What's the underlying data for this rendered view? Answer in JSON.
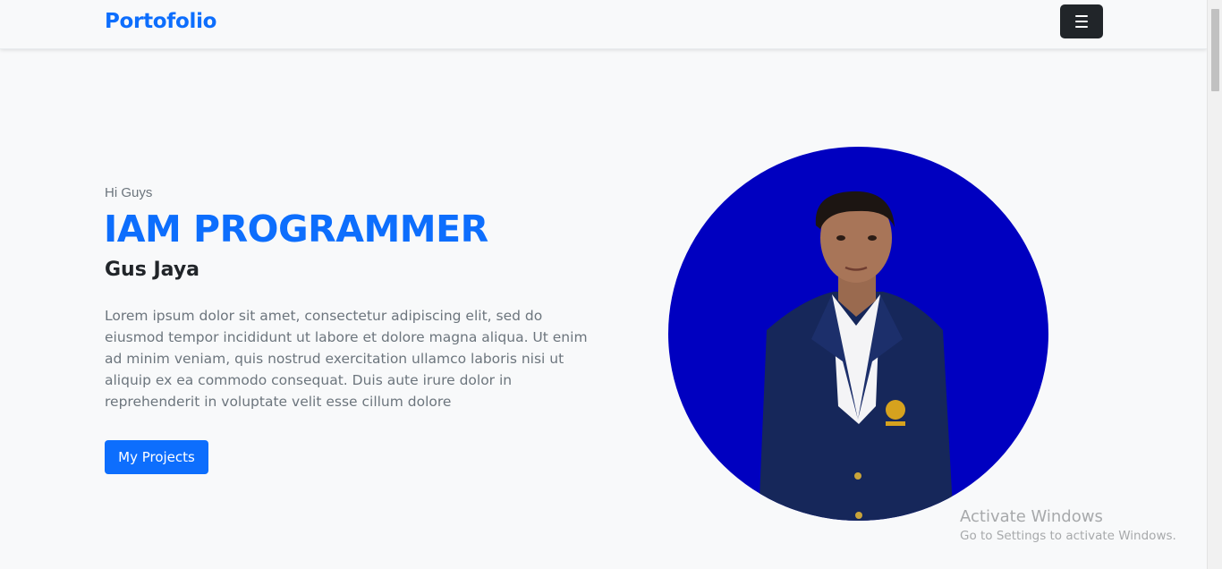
{
  "navbar": {
    "brand": "Portofolio",
    "toggler_icon": "hamburger-menu-icon"
  },
  "hero": {
    "greeting": "Hi Guys",
    "headline": "IAM PROGRAMMER",
    "name": "Gus Jaya",
    "bio": "Lorem ipsum dolor sit amet, consectetur adipiscing elit, sed do eiusmod tempor incididunt ut labore et dolore magna aliqua. Ut enim ad minim veniam, quis nostrud exercitation ullamco laboris nisi ut aliquip ex ea commodo consequat. Duis aute irure dolor in reprehenderit in voluptate velit esse cillum dolore",
    "cta_label": "My Projects",
    "portrait_background": "#0000c0"
  },
  "watermark": {
    "title": "Activate Windows",
    "subtitle": "Go to Settings to activate Windows."
  },
  "colors": {
    "accent": "#0d6efd",
    "dark": "#212529",
    "muted": "#6c757d",
    "background": "#f8f9fa"
  }
}
